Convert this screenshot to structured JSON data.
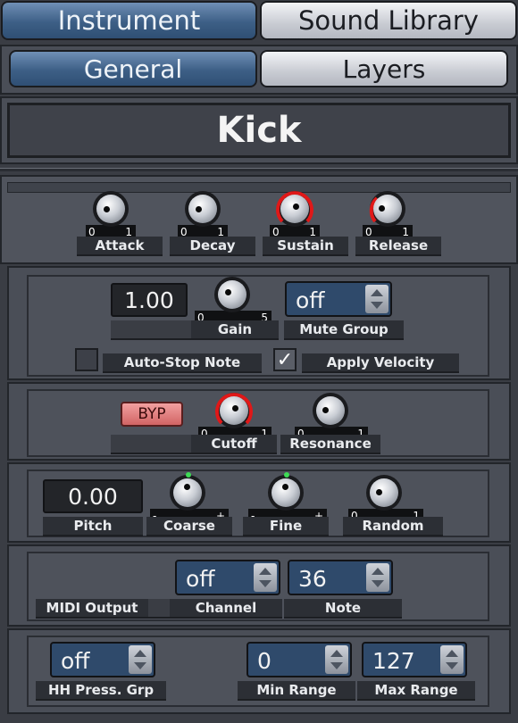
{
  "tabs": {
    "instrument": "Instrument",
    "sound_library": "Sound Library"
  },
  "subtabs": {
    "general": "General",
    "layers": "Layers"
  },
  "instrument_name": "Kick",
  "envelope": {
    "attack": {
      "label": "Attack",
      "min": "0",
      "max": "1"
    },
    "decay": {
      "label": "Decay",
      "min": "0",
      "max": "1"
    },
    "sustain": {
      "label": "Sustain",
      "min": "0",
      "max": "1"
    },
    "release": {
      "label": "Release",
      "min": "0",
      "max": "1"
    }
  },
  "gain_section": {
    "gain_value": "1.00",
    "gain_label": "Gain",
    "gain_min": "0",
    "gain_max": "5",
    "mute_group_value": "off",
    "mute_group_label": "Mute Group",
    "auto_stop_label": "Auto-Stop Note",
    "apply_velocity_label": "Apply Velocity",
    "apply_velocity_check": "✓"
  },
  "filter_section": {
    "bypass_label": "BYP",
    "cutoff_label": "Cutoff",
    "cutoff_min": "0",
    "cutoff_max": "1",
    "resonance_label": "Resonance",
    "resonance_min": "0",
    "resonance_max": "1"
  },
  "pitch_section": {
    "pitch_value": "0.00",
    "pitch_label": "Pitch",
    "coarse_label": "Coarse",
    "coarse_min": "-",
    "coarse_max": "+",
    "fine_label": "Fine",
    "fine_min": "-",
    "fine_max": "+",
    "random_label": "Random",
    "random_min": "0",
    "random_max": "1"
  },
  "midi_section": {
    "midi_output_label": "MIDI Output",
    "channel_value": "off",
    "channel_label": "Channel",
    "note_value": "36",
    "note_label": "Note"
  },
  "hihat_section": {
    "hh_press_value": "off",
    "hh_press_label": "HH Press. Grp",
    "min_range_value": "0",
    "min_range_label": "Min Range",
    "max_range_value": "127",
    "max_range_label": "Max Range"
  },
  "colors": {
    "active_tab": "#3d5f86",
    "inactive_tab": "#c8cbd2",
    "knob_arc": "#e01818",
    "led": "#3ddc55",
    "bypass": "#d26464"
  }
}
